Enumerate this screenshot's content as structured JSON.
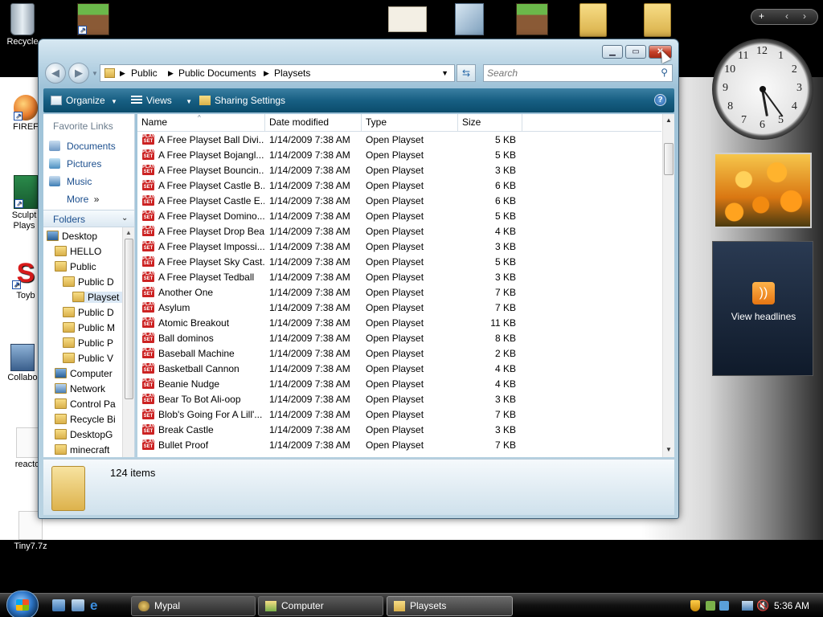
{
  "desktop": {
    "icons": [
      {
        "label": "Recycle",
        "icon": "recycle-bin-icon"
      },
      {
        "label": "FIREF",
        "icon": "firefox-icon"
      },
      {
        "label": "Sculpt Plays",
        "icon": "sculpt-icon"
      },
      {
        "label": "Toyb",
        "icon": "toybox-icon"
      },
      {
        "label": "Collabo",
        "icon": "network-app-icon"
      },
      {
        "label": "reacto",
        "icon": "file-icon"
      },
      {
        "label": "Tiny7.7z",
        "icon": "archive-icon"
      }
    ]
  },
  "window": {
    "address": {
      "segments": [
        "Public",
        "Public Documents",
        "Playsets"
      ]
    },
    "search": {
      "placeholder": "Search"
    },
    "toolbar": {
      "organize": "Organize",
      "views": "Views",
      "sharing": "Sharing Settings"
    },
    "nav": {
      "favorite_links_title": "Favorite Links",
      "links": [
        "Documents",
        "Pictures",
        "Music"
      ],
      "more": "More",
      "folders_title": "Folders",
      "tree": [
        "Desktop",
        "HELLO",
        "Public",
        "Public D",
        "Playset",
        "Public D",
        "Public M",
        "Public P",
        "Public V",
        "Computer",
        "Network",
        "Control Pa",
        "Recycle Bi",
        "DesktopG",
        "minecraft"
      ]
    },
    "columns": [
      "Name",
      "Date modified",
      "Type",
      "Size"
    ],
    "rows": [
      {
        "name": "A Free Playset Ball Divi...",
        "date": "1/14/2009 7:38 AM",
        "type": "Open Playset",
        "size": "5 KB"
      },
      {
        "name": "A Free Playset Bojangl...",
        "date": "1/14/2009 7:38 AM",
        "type": "Open Playset",
        "size": "5 KB"
      },
      {
        "name": "A Free Playset Bouncin...",
        "date": "1/14/2009 7:38 AM",
        "type": "Open Playset",
        "size": "3 KB"
      },
      {
        "name": "A Free Playset Castle B...",
        "date": "1/14/2009 7:38 AM",
        "type": "Open Playset",
        "size": "6 KB"
      },
      {
        "name": "A Free Playset Castle E...",
        "date": "1/14/2009 7:38 AM",
        "type": "Open Playset",
        "size": "6 KB"
      },
      {
        "name": "A Free Playset Domino...",
        "date": "1/14/2009 7:38 AM",
        "type": "Open Playset",
        "size": "5 KB"
      },
      {
        "name": "A Free Playset Drop Bear",
        "date": "1/14/2009 7:38 AM",
        "type": "Open Playset",
        "size": "4 KB"
      },
      {
        "name": "A Free Playset Impossi...",
        "date": "1/14/2009 7:38 AM",
        "type": "Open Playset",
        "size": "3 KB"
      },
      {
        "name": "A Free Playset Sky Cast...",
        "date": "1/14/2009 7:38 AM",
        "type": "Open Playset",
        "size": "5 KB"
      },
      {
        "name": "A Free Playset Tedball",
        "date": "1/14/2009 7:38 AM",
        "type": "Open Playset",
        "size": "3 KB"
      },
      {
        "name": "Another One",
        "date": "1/14/2009 7:38 AM",
        "type": "Open Playset",
        "size": "7 KB"
      },
      {
        "name": "Asylum",
        "date": "1/14/2009 7:38 AM",
        "type": "Open Playset",
        "size": "7 KB"
      },
      {
        "name": "Atomic Breakout",
        "date": "1/14/2009 7:38 AM",
        "type": "Open Playset",
        "size": "11 KB"
      },
      {
        "name": "Ball dominos",
        "date": "1/14/2009 7:38 AM",
        "type": "Open Playset",
        "size": "8 KB"
      },
      {
        "name": "Baseball Machine",
        "date": "1/14/2009 7:38 AM",
        "type": "Open Playset",
        "size": "2 KB"
      },
      {
        "name": "Basketball Cannon",
        "date": "1/14/2009 7:38 AM",
        "type": "Open Playset",
        "size": "4 KB"
      },
      {
        "name": "Beanie Nudge",
        "date": "1/14/2009 7:38 AM",
        "type": "Open Playset",
        "size": "4 KB"
      },
      {
        "name": "Bear To Bot Ali-oop",
        "date": "1/14/2009 7:38 AM",
        "type": "Open Playset",
        "size": "3 KB"
      },
      {
        "name": "Blob's Going For A Lill'...",
        "date": "1/14/2009 7:38 AM",
        "type": "Open Playset",
        "size": "7 KB"
      },
      {
        "name": "Break Castle",
        "date": "1/14/2009 7:38 AM",
        "type": "Open Playset",
        "size": "3 KB"
      },
      {
        "name": "Bullet Proof",
        "date": "1/14/2009 7:38 AM",
        "type": "Open Playset",
        "size": "7 KB"
      }
    ],
    "file_icon_text": "PLAY SET",
    "details": {
      "count": "124 items"
    }
  },
  "gadgets": {
    "clock_numbers": [
      "12",
      "1",
      "2",
      "3",
      "4",
      "5",
      "6",
      "7",
      "8",
      "9",
      "10",
      "11"
    ],
    "feed_text": "View headlines"
  },
  "taskbar": {
    "tasks": [
      "Mypal",
      "Computer",
      "Playsets"
    ],
    "time": "5:36 AM"
  },
  "colors": {
    "toolbar": "#175f83",
    "link": "#1c4f8e",
    "close": "#c6422a"
  }
}
